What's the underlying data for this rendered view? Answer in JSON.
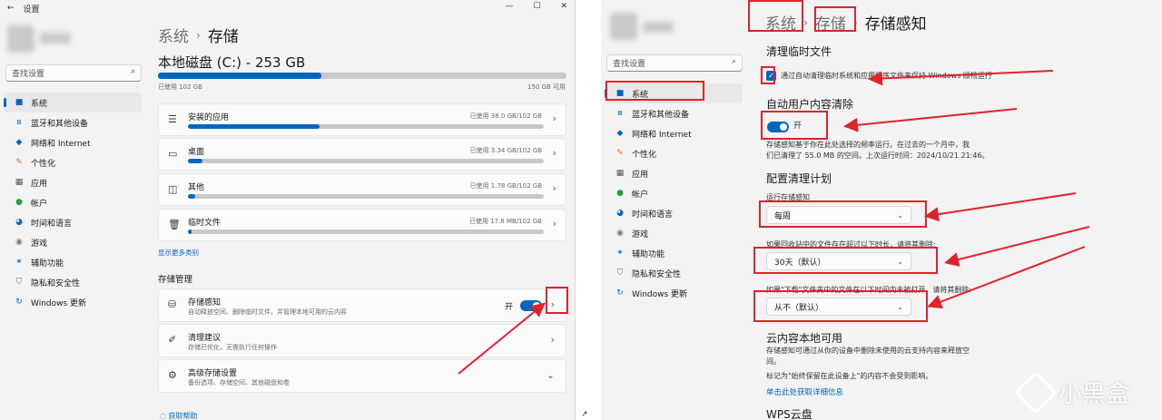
{
  "colors": {
    "accent": "#0067c0",
    "annotation": "#e0232b",
    "bg": "#f3f3f3"
  },
  "left": {
    "titlebar": {
      "back": "←",
      "title": "设置",
      "min": "—",
      "max": "☐",
      "close": "✕"
    },
    "search_placeholder": "查找设置",
    "nav": [
      {
        "icon": "■",
        "label": "系统"
      },
      {
        "icon": "ʙ",
        "label": "蓝牙和其他设备"
      },
      {
        "icon": "◆",
        "label": "网络和 Internet"
      },
      {
        "icon": "✎",
        "label": "个性化"
      },
      {
        "icon": "▦",
        "label": "应用"
      },
      {
        "icon": "●",
        "label": "帐户"
      },
      {
        "icon": "◕",
        "label": "时间和语言"
      },
      {
        "icon": "◉",
        "label": "游戏"
      },
      {
        "icon": "✶",
        "label": "辅助功能"
      },
      {
        "icon": "⛉",
        "label": "隐私和安全性"
      },
      {
        "icon": "↻",
        "label": "Windows 更新"
      }
    ],
    "breadcrumb": {
      "parent": "系统",
      "sep": "›",
      "current": "存储"
    },
    "disk": {
      "title": "本地磁盘 (C:) - 253 GB",
      "used": "已使用 102 GB",
      "free": "150 GB 可用",
      "fraction": 0.4
    },
    "categories": [
      {
        "icon": "☰",
        "name": "安装的应用",
        "used": "已使用 38.0 GB/102 GB",
        "fraction": 0.37
      },
      {
        "icon": "▭",
        "name": "桌面",
        "used": "已使用 3.34 GB/102 GB",
        "fraction": 0.04
      },
      {
        "icon": "◫",
        "name": "其他",
        "used": "已使用 1.78 GB/102 GB",
        "fraction": 0.02
      },
      {
        "icon": "🗑",
        "name": "临时文件",
        "used": "已使用 17.8 MB/102 GB",
        "fraction": 0.01
      }
    ],
    "more_link": "显示更多类别",
    "mgmt_title": "存储管理",
    "mgmt": [
      {
        "icon": "⛁",
        "name": "存储感知",
        "desc": "自动释放空间、删除临时文件，并管理本地可用的云内容",
        "toggle": "开",
        "chev": "›"
      },
      {
        "icon": "✐",
        "name": "清理建议",
        "desc": "存储已优化，无需执行任何操作",
        "chev": "›"
      },
      {
        "icon": "⚙",
        "name": "高级存储设置",
        "desc": "备份选项、存储空间、其他磁盘和卷",
        "chev": "⌄"
      }
    ],
    "help": "获取帮助"
  },
  "right": {
    "search_placeholder": "查找设置",
    "nav": [
      {
        "icon": "■",
        "label": "系统"
      },
      {
        "icon": "ʙ",
        "label": "蓝牙和其他设备"
      },
      {
        "icon": "◆",
        "label": "网络和 Internet"
      },
      {
        "icon": "✎",
        "label": "个性化"
      },
      {
        "icon": "▦",
        "label": "应用"
      },
      {
        "icon": "●",
        "label": "帐户"
      },
      {
        "icon": "◕",
        "label": "时间和语言"
      },
      {
        "icon": "◉",
        "label": "游戏"
      },
      {
        "icon": "✶",
        "label": "辅助功能"
      },
      {
        "icon": "⛉",
        "label": "隐私和安全性"
      },
      {
        "icon": "↻",
        "label": "Windows 更新"
      }
    ],
    "breadcrumb": {
      "a": "系统",
      "b": "存储",
      "c": "存储感知",
      "sep": "›"
    },
    "temp_title": "清理临时文件",
    "temp_check_label": "通过自动清理临时系统和应用程序文件来保持 Windows 顺畅运行",
    "auto_title": "自动用户内容清除",
    "toggle_label": "开",
    "auto_desc1": "存储感知基于你在此处选择的频率运行。在过去的一个月中，我",
    "auto_desc2": "们已清理了 55.0 MB 的空间。上次运行时间：2024/10/21 21:46。",
    "schedule_title": "配置清理计划",
    "run_label": "运行存储感知",
    "run_value": "每周",
    "recycle_label": "如果回收站中的文件存在超过以下时长，请将其删除:",
    "recycle_value": "30天（默认）",
    "downloads_label": "如果\"下载\"文件夹中的文件在以下时间内未被打开，请将其删除:",
    "downloads_value": "从不（默认）",
    "cloud_title": "云内容本地可用",
    "cloud_desc1": "存储感知可通过从你的设备中删除未使用的云支持内容来释放空",
    "cloud_desc2": "间。",
    "cloud_desc3": "标记为\"始终保留在此设备上\"的内容不会受到影响。",
    "cloud_link": "单击此处获取详细信息",
    "wps_title": "WPS云盘",
    "dd": "⌄"
  },
  "watermark": "小黑盒"
}
